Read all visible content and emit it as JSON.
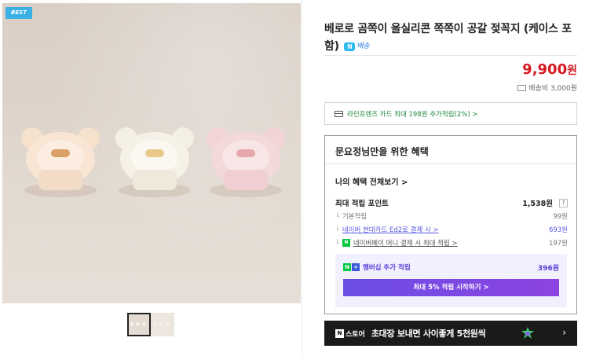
{
  "gallery": {
    "badge": "BEST"
  },
  "product": {
    "title": "베로로 곰쪽이 올실리콘 쪽쪽이 공갈 젖꼭지 (케이스 포함)",
    "delivery_badge": "배송",
    "delivery_badge_icon": "n-delivery-icon",
    "price_value": "9,900",
    "price_unit": "원",
    "shipping": "배송비 3,000원"
  },
  "card_promo": {
    "text": "라인프렌즈 카드 최대 198원 추가적립(2%) >"
  },
  "benefit": {
    "heading": "문요정님만을 위한 혜택",
    "all_link": "나의 혜택 전체보기 >",
    "max_points_label": "최대 적립 포인트",
    "max_points_value": "1,538원",
    "help": "?",
    "rows": [
      {
        "label": "기본적립",
        "value": "99원"
      },
      {
        "label": "네이버 현대카드 Ed2로 결제 시 >",
        "value": "693원"
      },
      {
        "label": "네이버페이 머니 결제 시 최대 적립 >",
        "value": "197원"
      }
    ],
    "npay_letter": "N",
    "member": {
      "n_letter": "N",
      "plus": "+",
      "label": "멤버십 추가 적립",
      "value": "396원",
      "button": "최대 5% 적립 시작하기 >"
    }
  },
  "banner": {
    "n_letter": "N",
    "store_label": "스토어",
    "text": "초대장 보내면 사이좋게 5천원씩",
    "chevron": "›"
  },
  "colors": {
    "price": "#d71920",
    "green": "#1f8a3c",
    "member_purple": "#5a3cd6",
    "badge_blue": "#3ab0e6"
  }
}
